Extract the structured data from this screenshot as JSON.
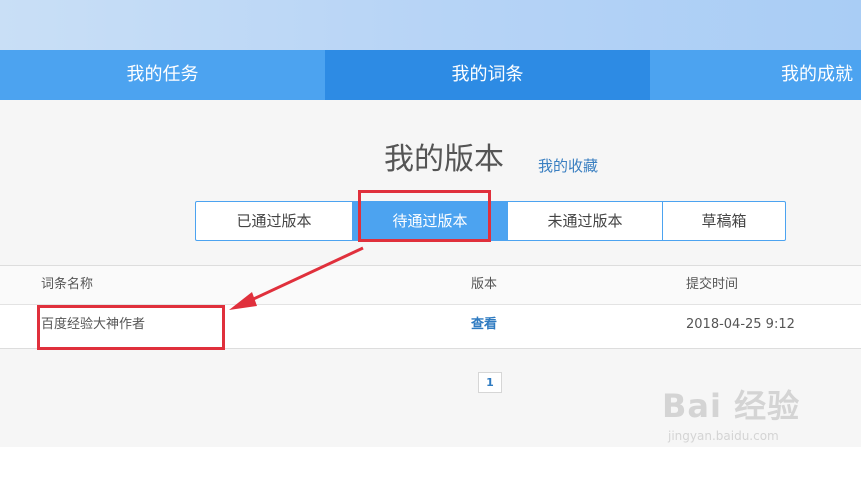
{
  "nav": {
    "tabs": [
      {
        "label": "我的任务"
      },
      {
        "label": "我的词条"
      },
      {
        "label": "我的成就"
      }
    ]
  },
  "header": {
    "title": "我的版本",
    "favorites_link": "我的收藏"
  },
  "segments": [
    {
      "label": "已通过版本"
    },
    {
      "label": "待通过版本"
    },
    {
      "label": "未通过版本"
    },
    {
      "label": "草稿箱"
    }
  ],
  "table": {
    "columns": [
      "词条名称",
      "版本",
      "提交时间"
    ],
    "rows": [
      {
        "name": "百度经验大神作者",
        "version": "查看",
        "time": "2018-04-25 9:12"
      }
    ]
  },
  "pagination": {
    "current": "1"
  },
  "watermark": {
    "brand": "Bai 经验",
    "url": "jingyan.baidu.com"
  },
  "colors": {
    "accent": "#4ca3f0",
    "nav_active": "#2d8be4",
    "highlight": "#e0303c"
  }
}
